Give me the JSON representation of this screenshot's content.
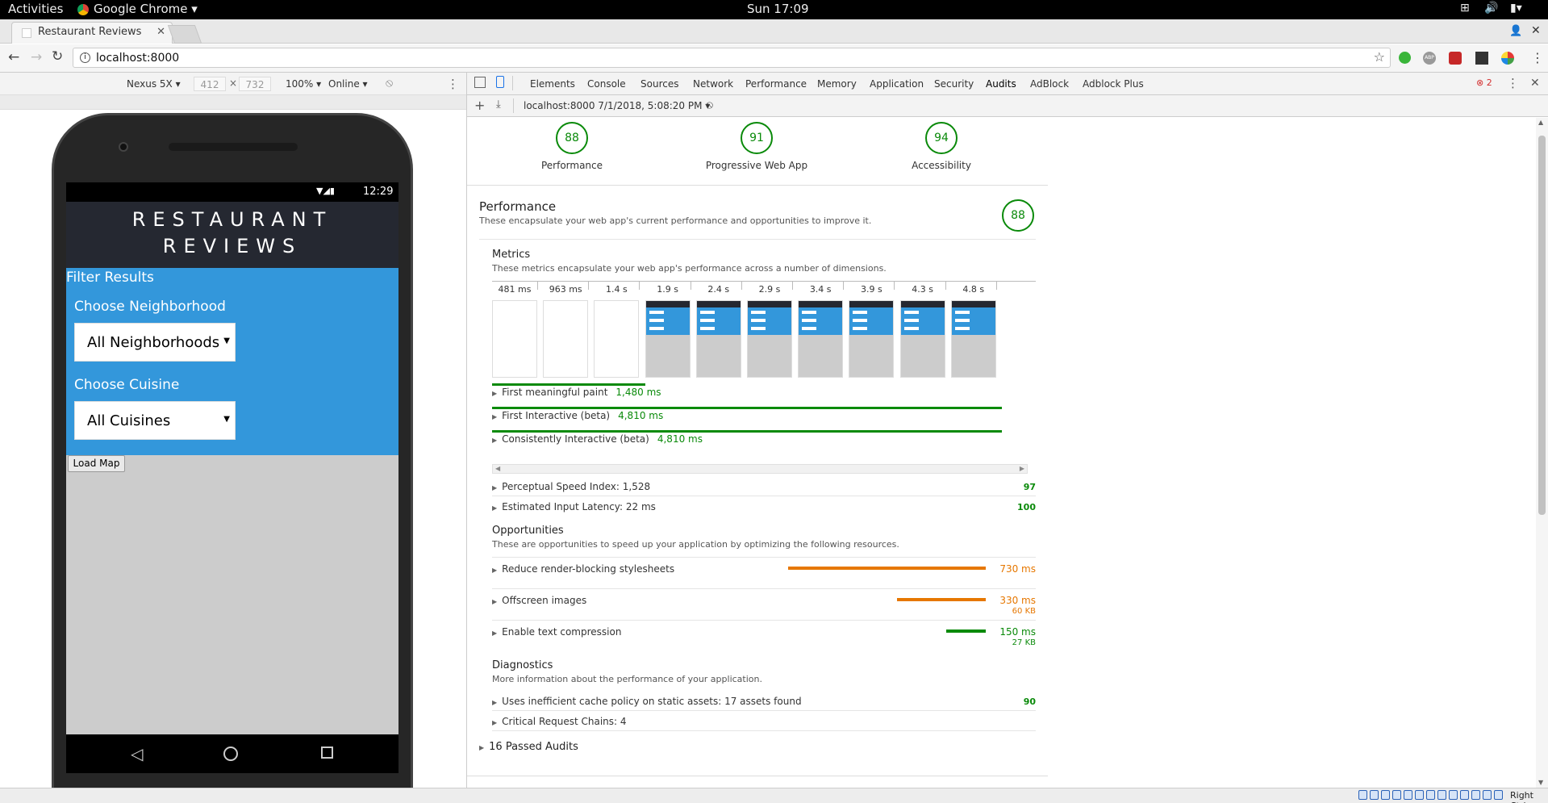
{
  "system": {
    "activities": "Activities",
    "app_name": "Google Chrome",
    "clock": "Sun 17:09"
  },
  "browser": {
    "tab_title": "Restaurant Reviews",
    "url": "localhost:8000"
  },
  "device_toolbar": {
    "device": "Nexus 5X",
    "width": "412",
    "height": "732",
    "zoom": "100%",
    "network": "Online"
  },
  "phone": {
    "time": "12:29",
    "app_title_line1": "RESTAURANT",
    "app_title_line2": "REVIEWS",
    "filter_title": "Filter Results",
    "neighborhood_label": "Choose Neighborhood",
    "neighborhood_value": "All Neighborhoods",
    "cuisine_label": "Choose Cuisine",
    "cuisine_value": "All Cuisines",
    "load_map": "Load Map"
  },
  "devtools": {
    "tabs": [
      "Elements",
      "Console",
      "Sources",
      "Network",
      "Performance",
      "Memory",
      "Application",
      "Security",
      "Audits",
      "AdBlock",
      "Adblock Plus"
    ],
    "active_tab": "Audits",
    "error_count": "2",
    "report_selector": "localhost:8000 7/1/2018, 5:08:20 PM"
  },
  "report": {
    "scores": [
      {
        "value": "88",
        "label": "Performance"
      },
      {
        "value": "91",
        "label": "Progressive Web App"
      },
      {
        "value": "94",
        "label": "Accessibility"
      }
    ],
    "perf_title": "Performance",
    "perf_desc": "These encapsulate your web app's current performance and opportunities to improve it.",
    "perf_score": "88",
    "metrics_title": "Metrics",
    "metrics_desc": "These metrics encapsulate your web app's performance across a number of dimensions.",
    "filmstrip_times": [
      "481 ms",
      "963 ms",
      "1.4 s",
      "1.9 s",
      "2.4 s",
      "2.9 s",
      "3.4 s",
      "3.9 s",
      "4.3 s",
      "4.8 s"
    ],
    "timeline_metrics": [
      {
        "name": "First meaningful paint",
        "value": "1,480 ms",
        "fraction": 0.3
      },
      {
        "name": "First Interactive (beta)",
        "value": "4,810 ms",
        "fraction": 1.0
      },
      {
        "name": "Consistently Interactive (beta)",
        "value": "4,810 ms",
        "fraction": 1.0
      }
    ],
    "scored_metrics": [
      {
        "name": "Perceptual Speed Index: 1,528",
        "score": "97"
      },
      {
        "name": "Estimated Input Latency: 22 ms",
        "score": "100"
      }
    ],
    "opp_title": "Opportunities",
    "opp_desc": "These are opportunities to speed up your application by optimizing the following resources.",
    "opportunities": [
      {
        "name": "Reduce render-blocking stylesheets",
        "time": "730 ms",
        "size": "",
        "fraction": 1.0,
        "color": "#e67700"
      },
      {
        "name": "Offscreen images",
        "time": "330 ms",
        "size": "60 KB",
        "fraction": 0.45,
        "color": "#e67700"
      },
      {
        "name": "Enable text compression",
        "time": "150 ms",
        "size": "27 KB",
        "fraction": 0.2,
        "color": "#0a8a0a"
      }
    ],
    "diag_title": "Diagnostics",
    "diag_desc": "More information about the performance of your application.",
    "diagnostics": [
      {
        "name": "Uses inefficient cache policy on static assets: 17 assets found",
        "score": "90"
      },
      {
        "name": "Critical Request Chains: 4",
        "score": ""
      }
    ],
    "passed": "16 Passed Audits"
  },
  "taskbar": {
    "right_ctrl": "Right Ctrl"
  }
}
